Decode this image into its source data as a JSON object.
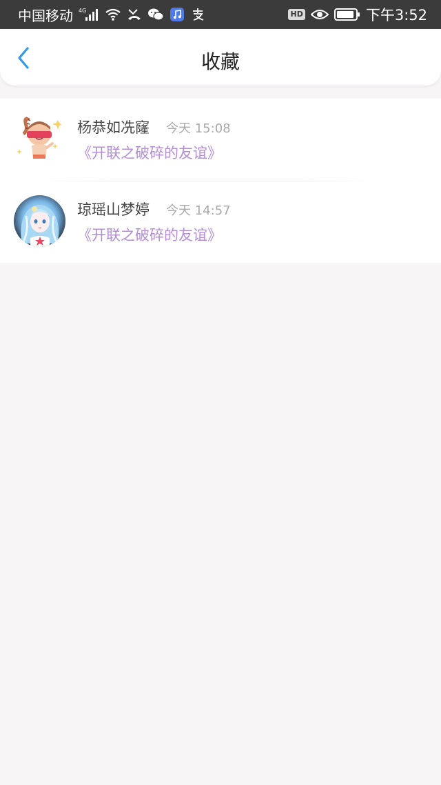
{
  "status_bar": {
    "carrier": "中国移动",
    "network": "4G",
    "time": "下午3:52",
    "hd_label": "HD",
    "icons": [
      "signal-icon",
      "wifi-icon",
      "missed-call-icon",
      "wechat-icon",
      "music-app-icon",
      "alipay-icon",
      "eye-comfort-icon",
      "battery-icon"
    ]
  },
  "header": {
    "title": "收藏",
    "back_icon": "chevron-left-icon",
    "accent_color": "#2f9be6"
  },
  "favorites": [
    {
      "user": "杨恭如冼窿",
      "time": "今天 15:08",
      "title": "《开联之破碎的友谊》",
      "avatar": "cartoon-avatar"
    },
    {
      "user": "琼瑶山梦婷",
      "time": "今天 14:57",
      "title": "《开联之破碎的友谊》",
      "avatar": "anime-girl-avatar"
    }
  ],
  "colors": {
    "title_link": "#b48ed9",
    "background": "#f7f5f6",
    "status_bar": "#3b3b3b"
  }
}
